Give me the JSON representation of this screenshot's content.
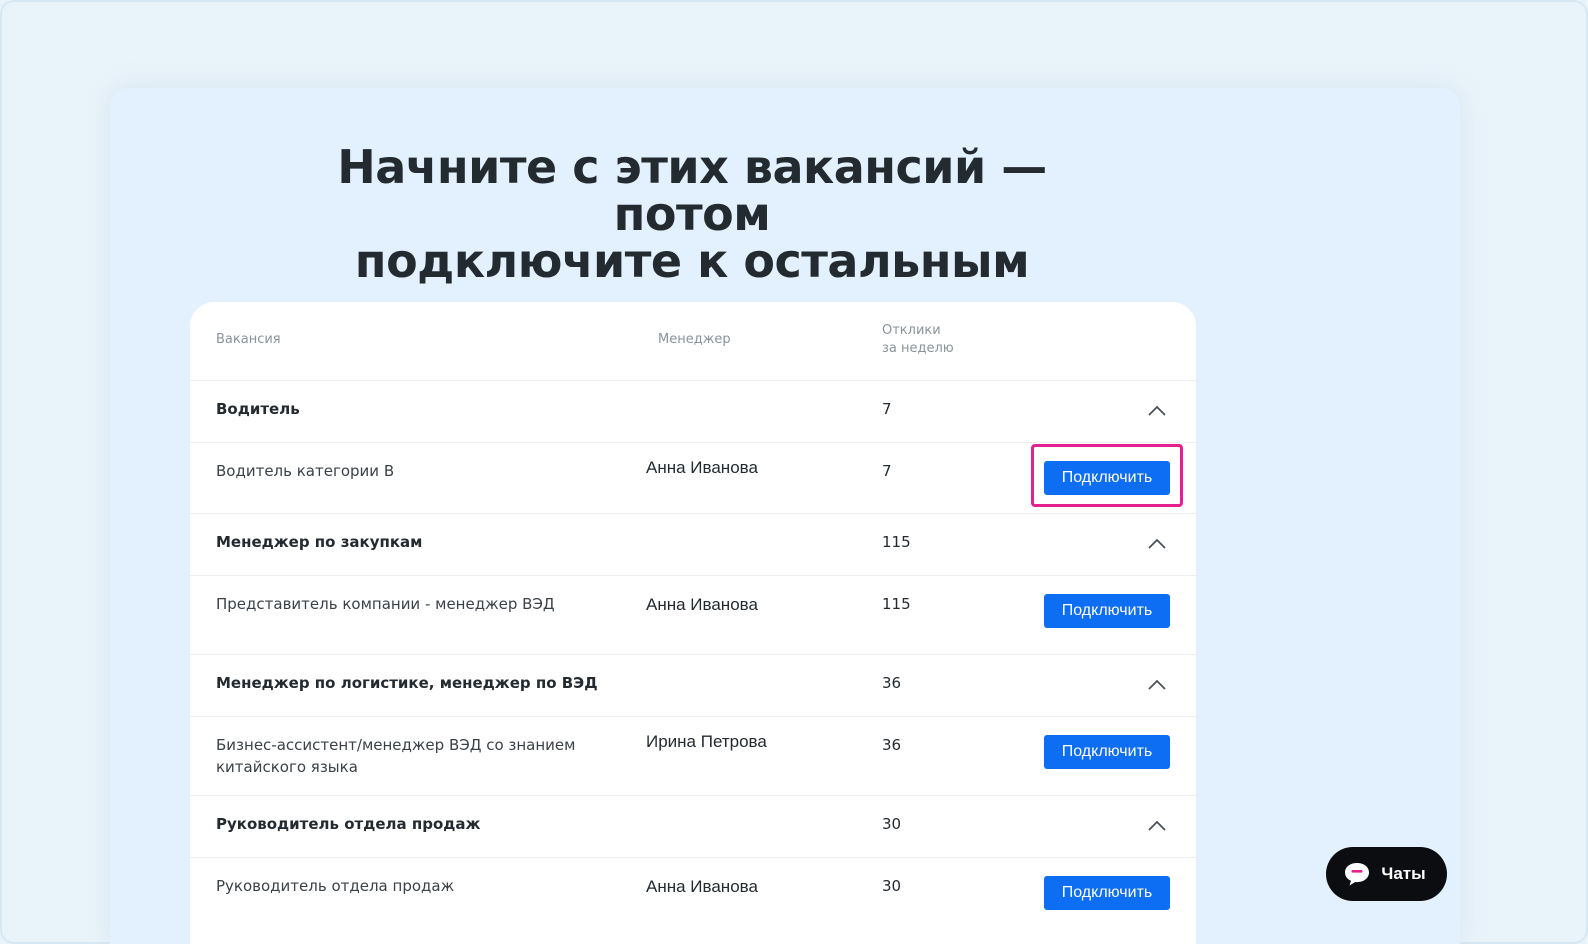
{
  "title": {
    "line1": "Начните с этих вакансий — потом",
    "line2": "подключите к остальным"
  },
  "table": {
    "headers": {
      "vacancy": "Вакансия",
      "manager": "Менеджер",
      "responses_line1": "Отклики",
      "responses_line2": "за неделю"
    },
    "groups": [
      {
        "name": "Водитель",
        "count": "7",
        "vacancy": {
          "line1": "Водитель категории B",
          "line2": "",
          "manager": "Анна Иванова",
          "count": "7",
          "button": "Подключить"
        }
      },
      {
        "name": "Менеджер по закупкам",
        "count": "115",
        "vacancy": {
          "line1": "Представитель компании - менеджер ВЭД",
          "line2": "",
          "manager": "Анна Иванова",
          "count": "115",
          "button": "Подключить"
        }
      },
      {
        "name": "Менеджер по логистике, менеджер по ВЭД",
        "count": "36",
        "vacancy": {
          "line1": "Бизнес-ассистент/менеджер ВЭД со знанием",
          "line2": "китайского языка",
          "manager": "Ирина Петрова",
          "count": "36",
          "button": "Подключить"
        }
      },
      {
        "name": "Руководитель отдела продаж",
        "count": "30",
        "vacancy": {
          "line1": "Руководитель отдела продаж",
          "line2": "",
          "manager": "Анна Иванова",
          "count": "30",
          "button": "Подключить"
        }
      }
    ]
  },
  "chats": {
    "label": "Чаты",
    "icon": "chat-bubble-icon"
  },
  "colors": {
    "accent": "#0d6ef4",
    "highlight": "#e5208f",
    "page_background": "#e9f3fa",
    "card_background": "#e3f0fd"
  }
}
